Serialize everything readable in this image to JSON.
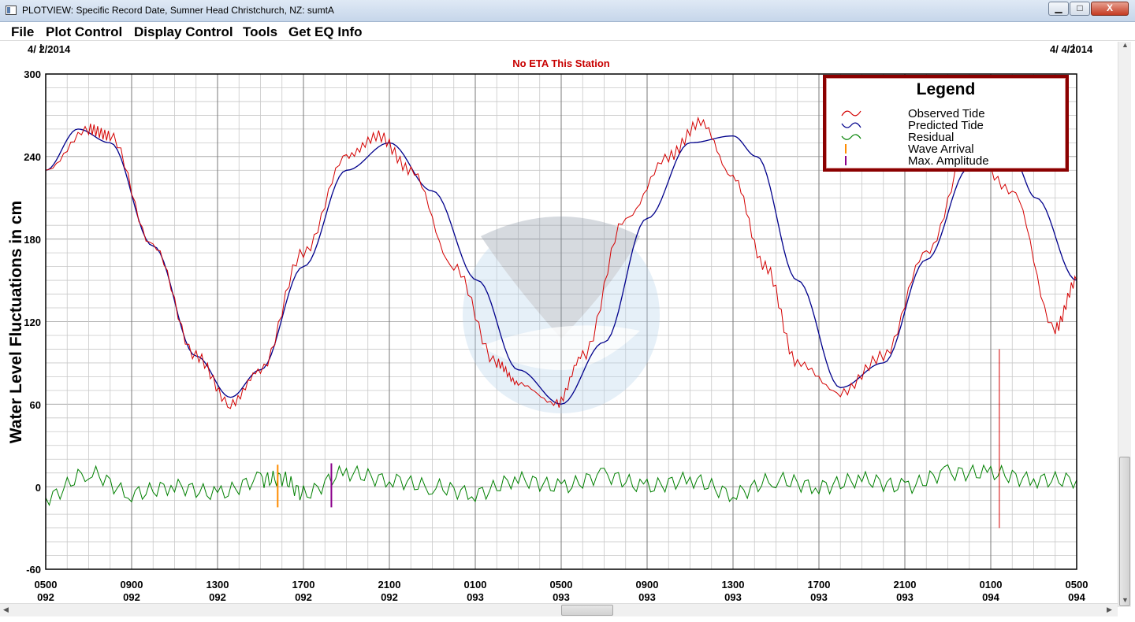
{
  "window": {
    "title": "PLOTVIEW: Specific Record Date, Sumner Head Christchurch, NZ: sumtA",
    "minimize_label": "▁",
    "maximize_label": "□",
    "close_label": "X"
  },
  "menu": {
    "items": [
      "File",
      "Plot Control",
      "Display Control",
      "Tools",
      "Get EQ Info"
    ]
  },
  "plot": {
    "date_start": "4/ 2/2014",
    "date_end": "4/ 4/2014",
    "eta_text": "No ETA This Station",
    "y_axis_label": "Water Level Fluctuations in cm",
    "y_ticks": [
      "300",
      "240",
      "180",
      "120",
      "60",
      "0",
      "-60"
    ],
    "x_ticks": [
      {
        "time": "0500",
        "day": "092"
      },
      {
        "time": "0900",
        "day": "092"
      },
      {
        "time": "1300",
        "day": "092"
      },
      {
        "time": "1700",
        "day": "092"
      },
      {
        "time": "2100",
        "day": "092"
      },
      {
        "time": "0100",
        "day": "093"
      },
      {
        "time": "0500",
        "day": "093"
      },
      {
        "time": "0900",
        "day": "093"
      },
      {
        "time": "1300",
        "day": "093"
      },
      {
        "time": "1700",
        "day": "093"
      },
      {
        "time": "2100",
        "day": "093"
      },
      {
        "time": "0100",
        "day": "094"
      },
      {
        "time": "0500",
        "day": "094"
      }
    ]
  },
  "legend": {
    "title": "Legend",
    "items": [
      {
        "label": "Observed Tide",
        "color": "#d40000",
        "icon": "wave-icon"
      },
      {
        "label": "Predicted Tide",
        "color": "#00008b",
        "icon": "wave-icon"
      },
      {
        "label": "Residual",
        "color": "#008000",
        "icon": "wave-icon"
      },
      {
        "label": "Wave Arrival",
        "color": "#ff8c00",
        "icon": "tick-icon"
      },
      {
        "label": "Max. Amplitude",
        "color": "#8b008b",
        "icon": "tick-icon"
      }
    ]
  },
  "chart_data": {
    "type": "line",
    "x_unit": "hours since 0500 day 092",
    "ylim": [
      -60,
      300
    ],
    "xlim": [
      0,
      48
    ],
    "grid": true,
    "series": [
      {
        "name": "Predicted Tide",
        "color": "#00008b",
        "x": [
          0,
          1.5,
          3,
          5,
          7,
          8.6,
          10,
          12,
          14,
          16,
          18,
          20.1,
          22,
          24,
          26,
          28,
          30,
          32,
          33.1,
          35,
          37,
          39,
          41,
          43,
          45,
          46.1,
          48
        ],
        "y": [
          230,
          260,
          250,
          175,
          95,
          65,
          85,
          160,
          230,
          250,
          215,
          150,
          85,
          60,
          105,
          195,
          250,
          255,
          240,
          150,
          72,
          90,
          165,
          232,
          240,
          210,
          150
        ]
      },
      {
        "name": "Observed Tide",
        "color": "#d40000",
        "x": [
          0,
          2,
          3,
          5,
          7,
          8.6,
          10,
          12,
          14,
          15.5,
          17,
          19,
          21,
          22,
          23.8,
          25,
          27,
          29,
          30.5,
          32,
          33.5,
          35,
          37,
          39,
          41,
          43,
          45,
          47,
          48
        ],
        "y": [
          230,
          260,
          255,
          175,
          95,
          60,
          85,
          170,
          240,
          255,
          230,
          160,
          90,
          75,
          60,
          95,
          195,
          240,
          265,
          225,
          160,
          90,
          68,
          95,
          170,
          245,
          215,
          115,
          150
        ]
      },
      {
        "name": "Residual",
        "color": "#008000",
        "x": [
          0,
          2,
          4,
          6,
          8,
          10,
          11,
          12,
          14,
          16,
          18,
          20,
          22,
          24,
          26,
          28,
          30,
          32,
          34,
          36,
          38,
          40,
          42,
          44,
          46,
          48
        ],
        "y": [
          -8,
          10,
          -5,
          0,
          -5,
          5,
          6,
          -5,
          10,
          5,
          0,
          -5,
          5,
          0,
          8,
          0,
          5,
          -5,
          5,
          0,
          5,
          0,
          10,
          10,
          5,
          5
        ]
      }
    ],
    "markers": {
      "wave_arrival_x": 10.8,
      "max_amplitude_x": 13.3,
      "spike_x": 44.4,
      "spike_min": -30
    }
  }
}
